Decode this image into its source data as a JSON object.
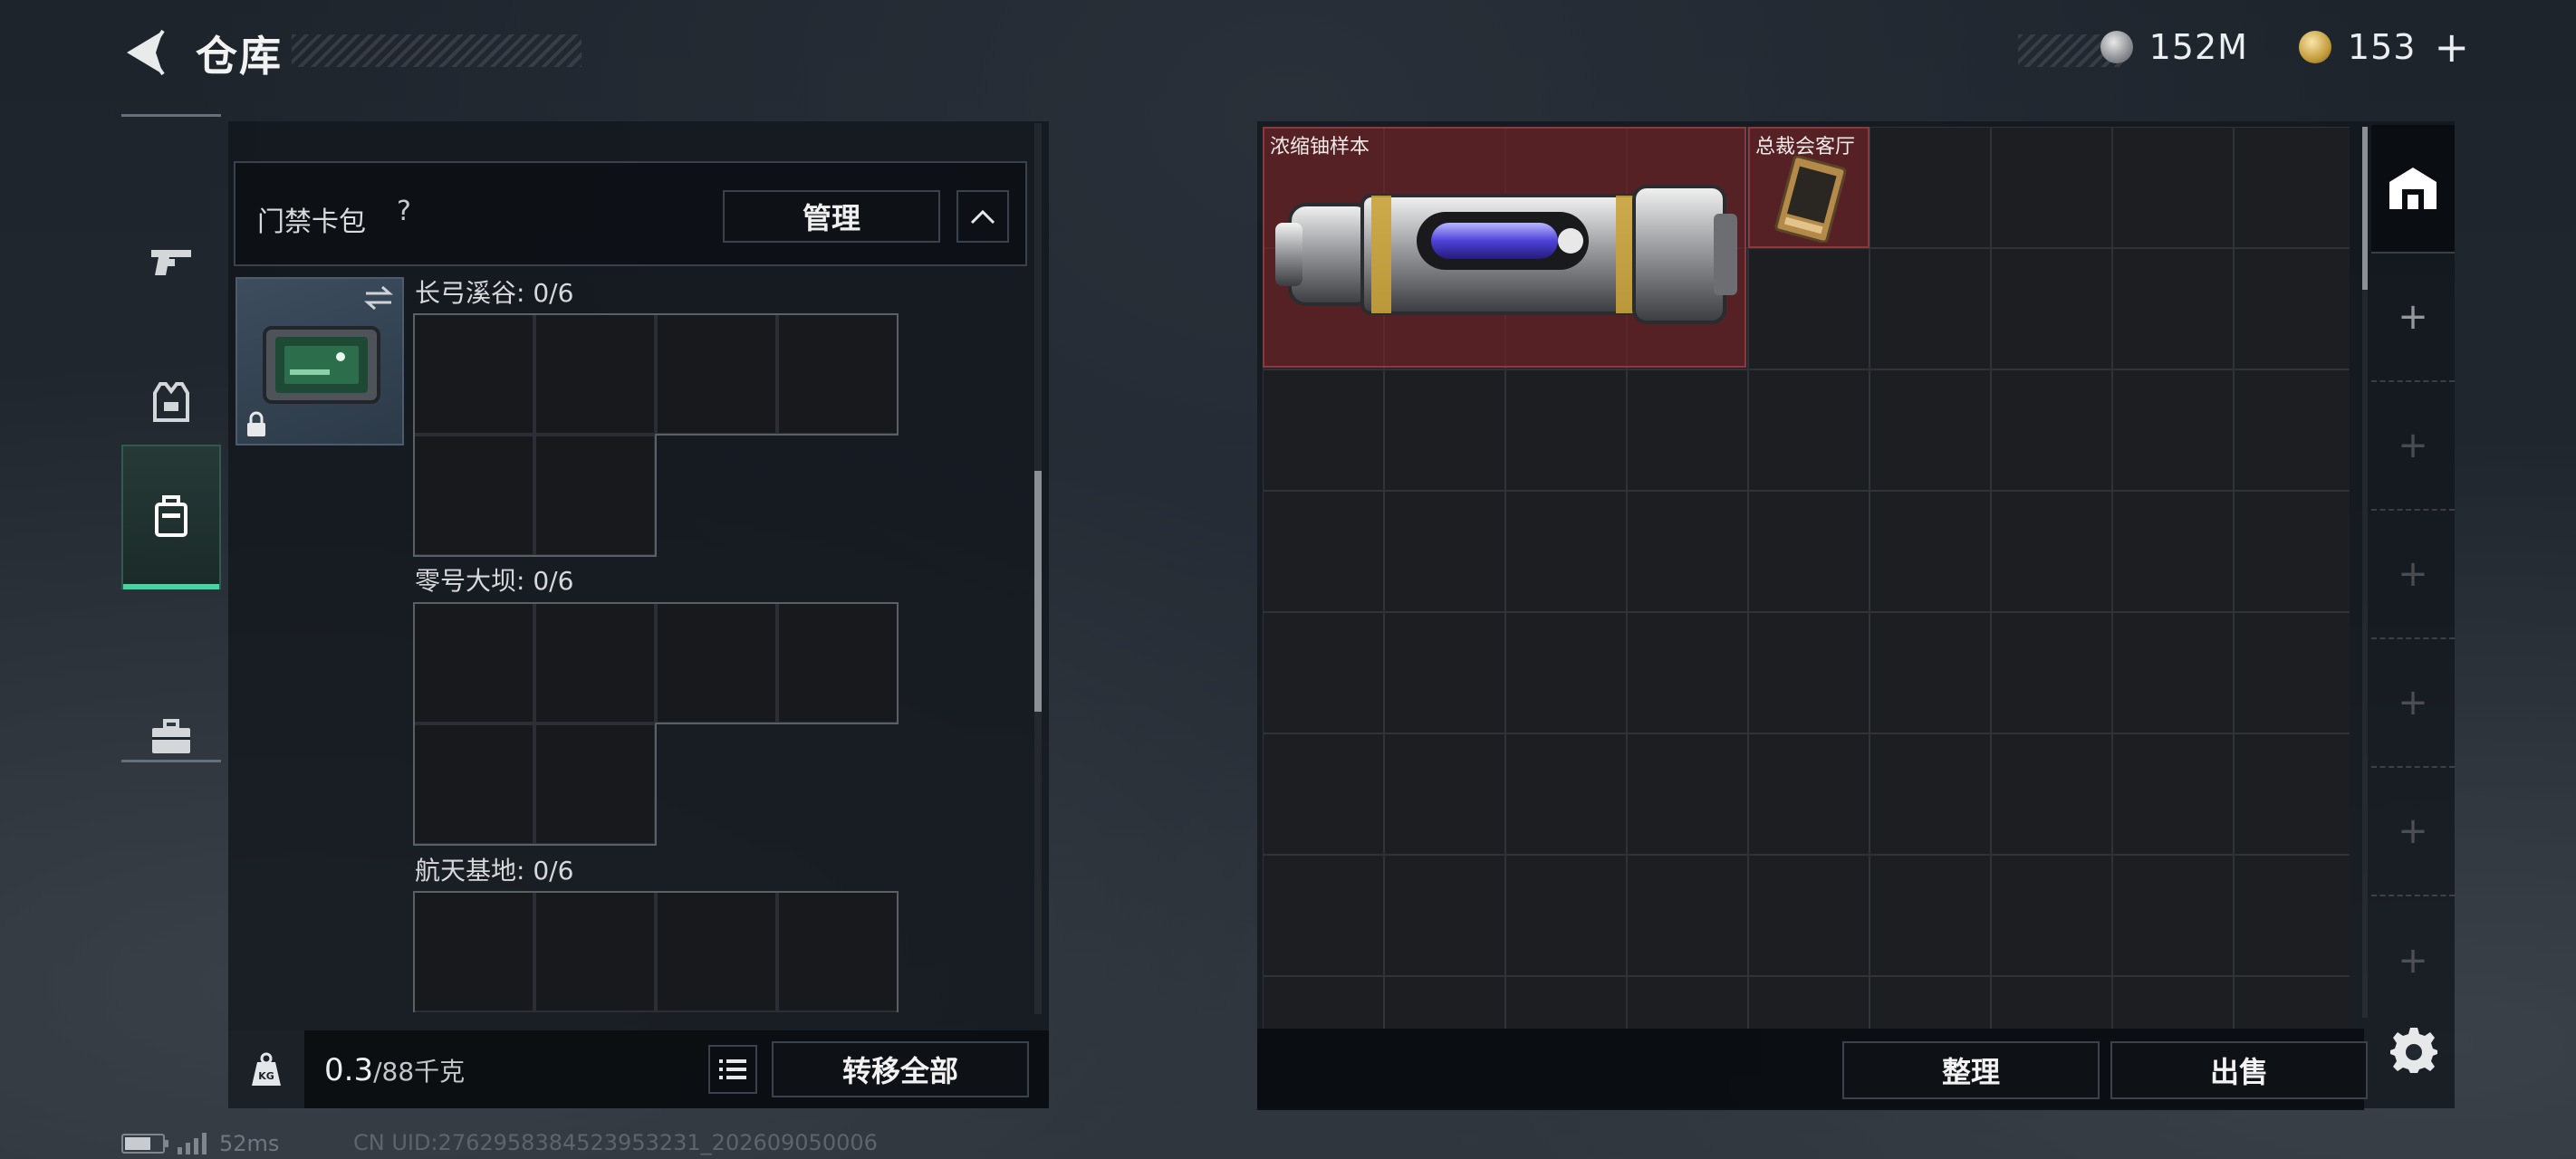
{
  "header": {
    "title": "仓库",
    "currencies": [
      {
        "icon": "silver-coin-icon",
        "value": "152M"
      },
      {
        "icon": "gold-coin-icon",
        "value": "153",
        "suffix": "+"
      }
    ]
  },
  "side_tabs": [
    {
      "name": "weapons",
      "icon": "pistol-icon",
      "active": false
    },
    {
      "name": "gear",
      "icon": "vest-icon",
      "active": false
    },
    {
      "name": "containers",
      "icon": "case-icon",
      "active": true
    },
    {
      "name": "tools",
      "icon": "toolbox-icon",
      "active": false
    }
  ],
  "keycard_section": {
    "title": "门禁卡包",
    "help": "?",
    "manage_label": "管理",
    "maps": [
      {
        "label": "长弓溪谷: 0/6"
      },
      {
        "label": "零号大坝: 0/6"
      },
      {
        "label": "航天基地: 0/6"
      }
    ]
  },
  "weight": {
    "current": "0.3",
    "max": "/88千克"
  },
  "left_actions": {
    "transfer_all_label": "转移全部"
  },
  "storage": {
    "items": [
      {
        "name": "浓缩铀样本",
        "icon": "uranium-canister-icon"
      },
      {
        "name": "总裁会客厅",
        "icon": "access-card-icon"
      }
    ],
    "sort_label": "整理",
    "sell_label": "出售"
  },
  "container_slots": [
    "+",
    "+",
    "+",
    "+",
    "+",
    "+"
  ],
  "status_bar": {
    "battery_level": 0.7,
    "ping": "52ms",
    "uid": "CN UID:2762958384523953231_202609050006"
  }
}
